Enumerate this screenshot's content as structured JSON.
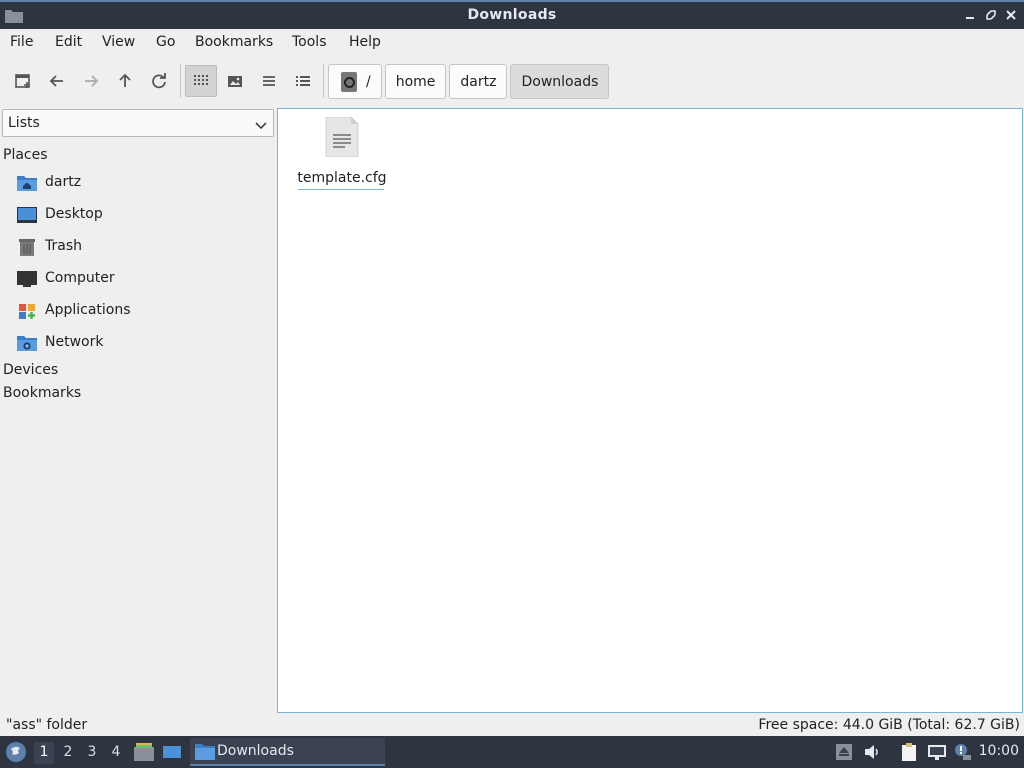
{
  "window": {
    "title": "Downloads"
  },
  "menu": [
    "File",
    "Edit",
    "View",
    "Go",
    "Bookmarks",
    "Tools",
    "Help"
  ],
  "toolbar": {
    "buttons": [
      "new-tab-icon",
      "back-arrow-icon",
      "forward-arrow-icon",
      "up-arrow-icon",
      "reload-icon",
      "icon-view-icon",
      "thumbnail-view-icon",
      "compact-view-icon",
      "detailed-list-icon"
    ],
    "active_view": "icon-view"
  },
  "breadcrumb": {
    "root": "/",
    "parts": [
      "home",
      "dartz",
      "Downloads"
    ]
  },
  "sidebar": {
    "mode": "Lists",
    "sections": {
      "places": "Places",
      "devices": "Devices",
      "bookmarks": "Bookmarks"
    },
    "places": [
      {
        "label": "dartz",
        "icon": "home-folder-icon"
      },
      {
        "label": "Desktop",
        "icon": "desktop-icon"
      },
      {
        "label": "Trash",
        "icon": "trash-icon"
      },
      {
        "label": "Computer",
        "icon": "computer-icon"
      },
      {
        "label": "Applications",
        "icon": "applications-icon"
      },
      {
        "label": "Network",
        "icon": "network-folder-icon"
      }
    ]
  },
  "files": [
    {
      "name": "template.cfg",
      "icon": "text-file-icon"
    }
  ],
  "status": {
    "left": "\"ass\" folder",
    "right": "Free space: 44.0 GiB (Total: 62.7 GiB)"
  },
  "taskbar": {
    "workspaces": [
      "1",
      "2",
      "3",
      "4"
    ],
    "active_workspace": "1",
    "task_label": "Downloads",
    "clock": "10:00"
  },
  "colors": {
    "titlebar": "#2e3440",
    "accent": "#5e81ac",
    "selection_border": "#7fb3d5",
    "folder_blue": "#4a8fd8"
  }
}
